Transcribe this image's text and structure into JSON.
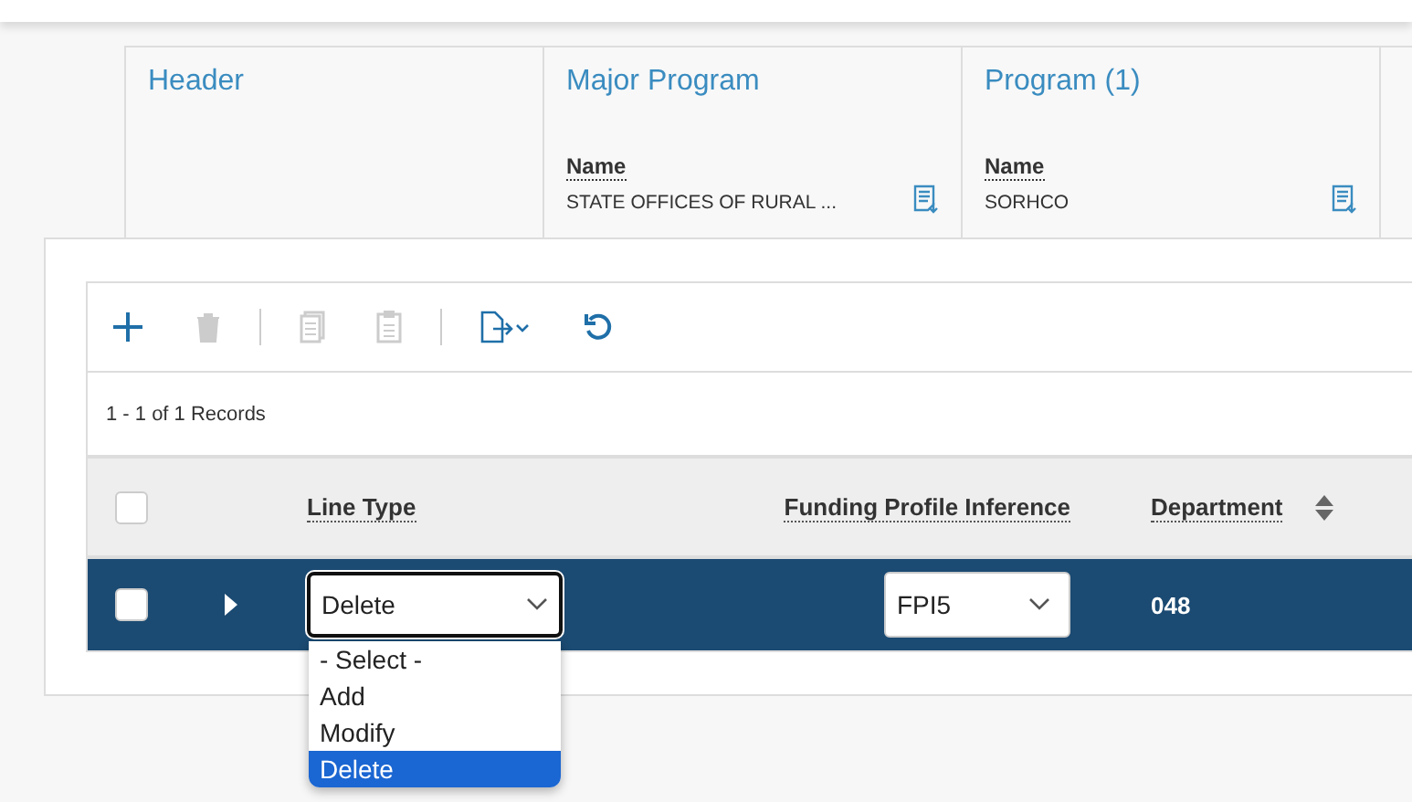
{
  "header_card": {
    "columns": [
      {
        "title": "Header"
      },
      {
        "title": "Major Program",
        "field_label": "Name",
        "value": "STATE OFFICES OF RURAL ..."
      },
      {
        "title": "Program (1)",
        "field_label": "Name",
        "value": "SORHCO"
      }
    ]
  },
  "toolbar": {
    "buttons": [
      {
        "kind": "add",
        "disabled": false
      },
      {
        "kind": "delete",
        "disabled": true
      },
      {
        "kind": "divider"
      },
      {
        "kind": "copy",
        "disabled": true
      },
      {
        "kind": "paste",
        "disabled": true
      },
      {
        "kind": "divider"
      },
      {
        "kind": "export",
        "disabled": false
      },
      {
        "kind": "refresh",
        "disabled": false
      }
    ]
  },
  "record_count": "1 - 1 of 1 Records",
  "grid": {
    "header_checked": false,
    "columns": [
      {
        "label": "Line Type",
        "sortable": false
      },
      {
        "label": "Funding Profile Inference",
        "sortable": false
      },
      {
        "label": "Department",
        "sortable": true
      }
    ],
    "rows": [
      {
        "selected": true,
        "checked": false,
        "expanded": false,
        "line_type": "Delete",
        "funding_profile": "FPI5",
        "department": "048"
      }
    ]
  },
  "dropdown": {
    "options": [
      {
        "label": "- Select -",
        "selected": false
      },
      {
        "label": "Add",
        "selected": false
      },
      {
        "label": "Modify",
        "selected": false
      },
      {
        "label": "Delete",
        "selected": true
      }
    ]
  }
}
